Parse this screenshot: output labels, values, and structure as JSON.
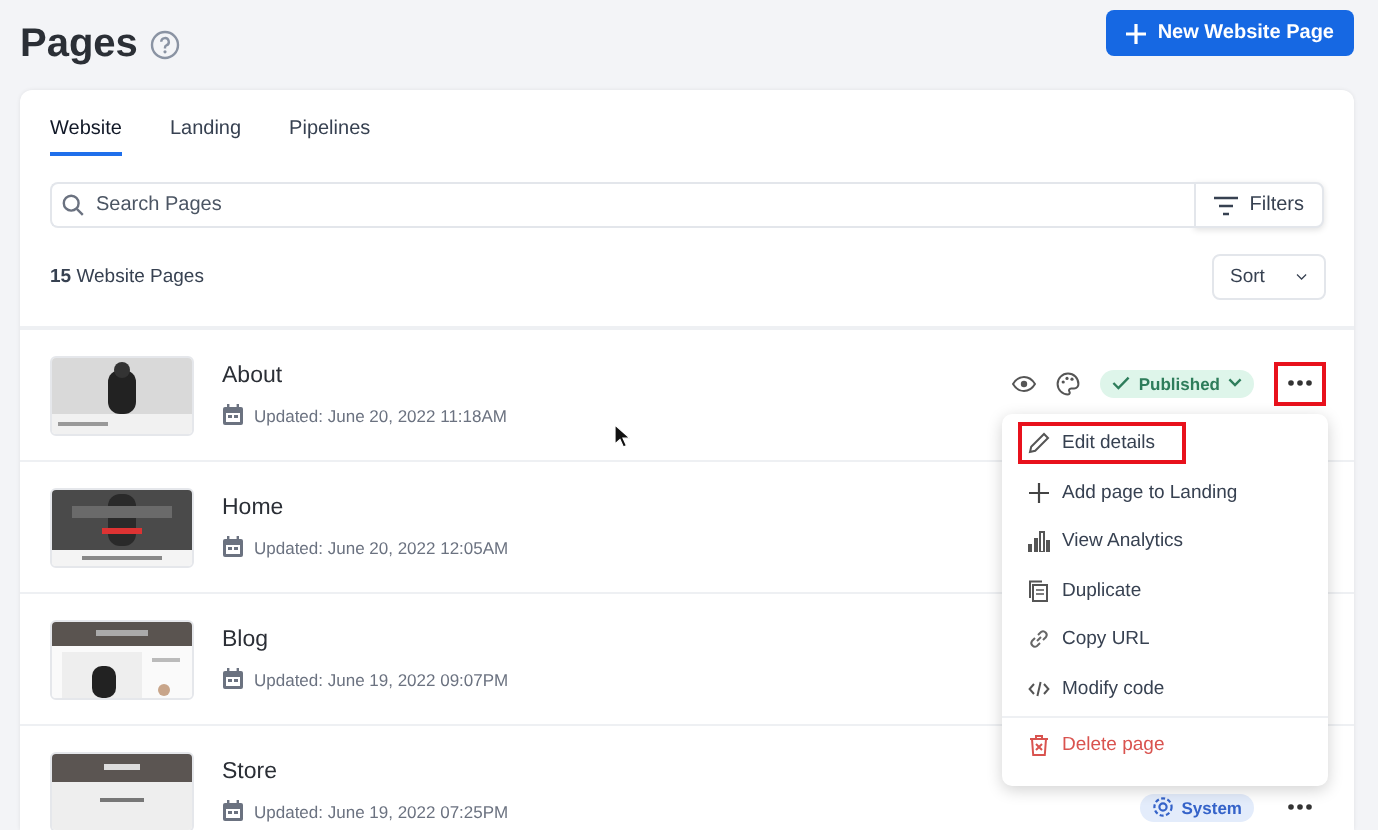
{
  "page": {
    "title": "Pages"
  },
  "new_button": {
    "label": "New Website Page"
  },
  "tabs": [
    {
      "label": "Website",
      "selected": true
    },
    {
      "label": "Landing",
      "selected": false
    },
    {
      "label": "Pipelines",
      "selected": false
    }
  ],
  "search": {
    "placeholder": "Search Pages"
  },
  "filters_button": {
    "label": "Filters"
  },
  "count": "**15** Website Pages",
  "sort": {
    "label": "Sort"
  },
  "pages": [
    {
      "title": "About",
      "updated": "Updated: June 20, 2022 11:18AM",
      "quick_actions": true,
      "status": {
        "kind": "published",
        "label": "Published"
      },
      "more_button": {
        "highlighted": true
      }
    },
    {
      "title": "Home",
      "updated": "Updated: June 20, 2022 12:05AM"
    },
    {
      "title": "Blog",
      "updated": "Updated: June 19, 2022 09:07PM"
    },
    {
      "title": "Store",
      "updated": "Updated: June 19, 2022 07:25PM",
      "status": {
        "kind": "system",
        "label": "System"
      },
      "more_button": {
        "highlighted": false
      }
    }
  ],
  "menu": {
    "items": [
      {
        "label": "Edit details",
        "kind": "edit",
        "highlighted": true
      },
      {
        "label": "Add page to Landing",
        "kind": "add",
        "highlighted": false
      },
      {
        "label": "View Analytics",
        "kind": "analytics",
        "highlighted": false
      },
      {
        "label": "Duplicate",
        "kind": "duplicate",
        "highlighted": false
      },
      {
        "label": "Copy URL",
        "kind": "link",
        "highlighted": false
      },
      {
        "label": "Modify code",
        "kind": "code",
        "highlighted": false
      },
      {
        "label": "Delete page",
        "kind": "delete",
        "highlighted": false
      }
    ]
  }
}
